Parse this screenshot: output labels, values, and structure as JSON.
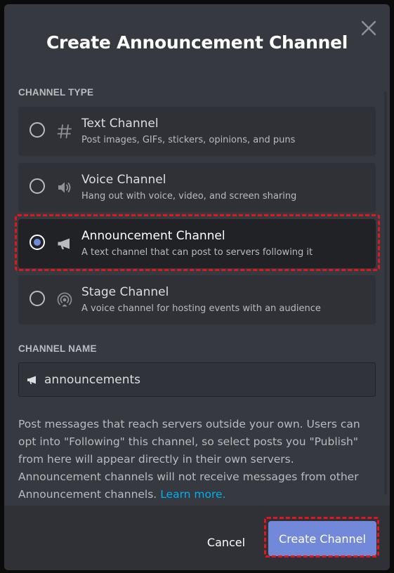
{
  "dialog": {
    "title": "Create Announcement Channel",
    "close_icon": "close-icon"
  },
  "channel_type": {
    "label": "CHANNEL TYPE",
    "options": [
      {
        "name": "Text Channel",
        "description": "Post images, GIFs, stickers, opinions, and puns",
        "icon": "hash-icon",
        "selected": false
      },
      {
        "name": "Voice Channel",
        "description": "Hang out with voice, video, and screen sharing",
        "icon": "speaker-icon",
        "selected": false
      },
      {
        "name": "Announcement Channel",
        "description": "A text channel that can post to servers following it",
        "icon": "megaphone-icon",
        "selected": true
      },
      {
        "name": "Stage Channel",
        "description": "A voice channel for hosting events with an audience",
        "icon": "stage-icon",
        "selected": false
      }
    ]
  },
  "channel_name": {
    "label": "CHANNEL NAME",
    "value": "announcements",
    "icon": "megaphone-icon"
  },
  "help": {
    "text": "Post messages that reach servers outside your own. Users can opt into \"Following\" this channel, so select posts you \"Publish\" from here will appear directly in their own servers. Announcement channels will not receive messages from other Announcement channels.",
    "link_text": "Learn more."
  },
  "footer": {
    "cancel_label": "Cancel",
    "create_label": "Create Channel"
  },
  "colors": {
    "modal_bg": "#36393f",
    "accent": "#7289da",
    "link": "#00aff4",
    "highlight": "#e0171c"
  }
}
